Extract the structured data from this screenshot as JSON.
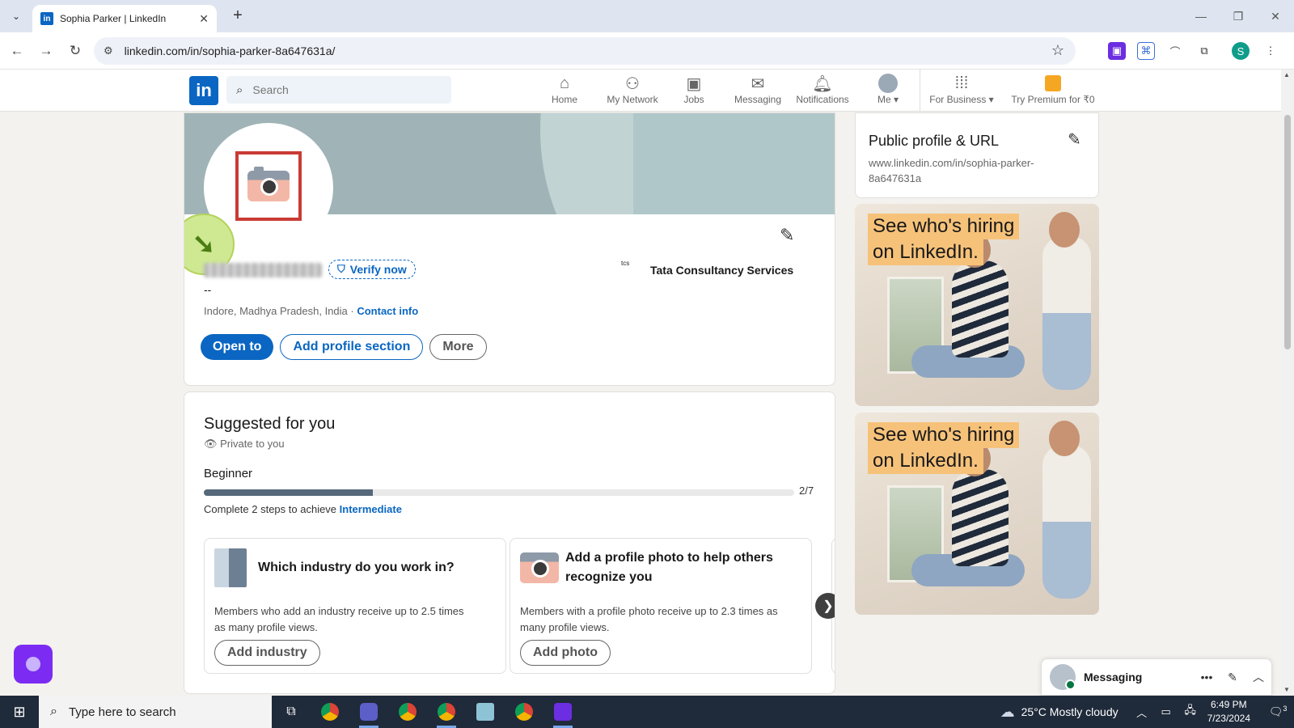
{
  "browser": {
    "tab_title": "Sophia Parker | LinkedIn",
    "tab_favicon": "in",
    "new_tab": "+",
    "url": "linkedin.com/in/sophia-parker-8a647631a/",
    "profile_initial": "S"
  },
  "linkedin_nav": {
    "logo": "in",
    "search_placeholder": "Search",
    "items": [
      {
        "label": "Home",
        "icon": "home-icon"
      },
      {
        "label": "My Network",
        "icon": "network-icon"
      },
      {
        "label": "Jobs",
        "icon": "briefcase-icon"
      },
      {
        "label": "Messaging",
        "icon": "chat-icon"
      },
      {
        "label": "Notifications",
        "icon": "bell-icon"
      },
      {
        "label": "Me ▾",
        "icon": "avatar-icon"
      },
      {
        "label": "For Business ▾",
        "icon": "grid-icon"
      },
      {
        "label": "Try Premium for ₹0",
        "icon": "premium-icon"
      }
    ]
  },
  "profile": {
    "verify_label": "Verify now",
    "headline": "--",
    "location": "Indore, Madhya Pradesh, India · ",
    "contact_info": "Contact info",
    "company_logo": "tcs",
    "company": "Tata Consultancy Services",
    "buttons": {
      "open_to": "Open to",
      "add_section": "Add profile section",
      "more": "More"
    }
  },
  "suggested": {
    "title": "Suggested for you",
    "private": "Private to you",
    "level": "Beginner",
    "progress": 0.2857,
    "progress_text": "2/7",
    "steps_prefix": "Complete 2 steps to achieve ",
    "steps_link": "Intermediate",
    "cards": [
      {
        "title": "Which industry do you work in?",
        "text": "Members who add an industry receive up to 2.5 times as many profile views.",
        "button": "Add industry"
      },
      {
        "title": "Add a profile photo to help others recognize you",
        "text": "Members with a profile photo receive up to 2.3 times as many profile views.",
        "button": "Add photo"
      }
    ],
    "next_label": "❯"
  },
  "right_rail": {
    "public_profile_title": "Public profile & URL",
    "public_profile_url": "www.linkedin.com/in/sophia-parker-8a647631a",
    "ads": [
      {
        "line1": "See who's hiring",
        "line2": "on LinkedIn."
      },
      {
        "line1": "See who's hiring",
        "line2": "on LinkedIn."
      }
    ]
  },
  "messaging": {
    "label": "Messaging"
  },
  "taskbar": {
    "search_text": "Type here to search",
    "temperature": "25°C",
    "weather": "Mostly cloudy",
    "time": "6:49 PM",
    "date": "7/23/2024",
    "notification_count": "3"
  }
}
